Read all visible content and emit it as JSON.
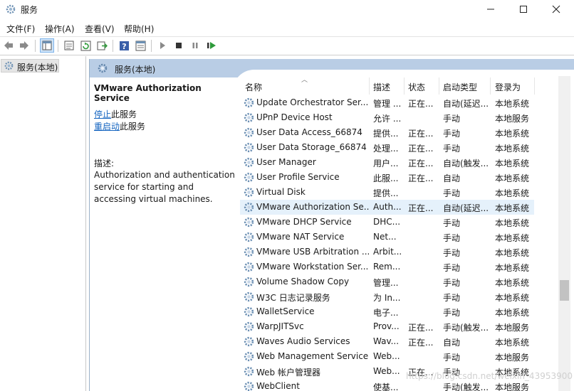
{
  "window": {
    "title": "服务",
    "minimize_icon": "minimize-icon",
    "maximize_icon": "maximize-icon",
    "close_icon": "close-icon"
  },
  "menu": [
    "文件(F)",
    "操作(A)",
    "查看(V)",
    "帮助(H)"
  ],
  "toolbar": {
    "icons": [
      "back-arrow-icon",
      "forward-arrow-icon",
      "show-console-tree-icon",
      "export-list-icon",
      "refresh-icon",
      "export-icon",
      "help-icon",
      "properties-icon",
      "start-service-icon",
      "stop-service-icon",
      "pause-service-icon",
      "restart-service-icon"
    ]
  },
  "tree": {
    "root_label": "服务(本地)"
  },
  "panel": {
    "header_label": "服务(本地)"
  },
  "details": {
    "service_title": "VMware Authorization Service",
    "stop_link": "停止",
    "stop_suffix": "此服务",
    "restart_link": "重启动",
    "restart_suffix": "此服务",
    "desc_label": "描述:",
    "desc_text": "Authorization and authentication service for starting and accessing virtual machines."
  },
  "list": {
    "columns": {
      "name": "名称",
      "desc": "描述",
      "status": "状态",
      "startup": "启动类型",
      "logon": "登录为"
    },
    "sorted_column": "名称",
    "selected_row": "VMware Authorization Se...",
    "rows": [
      {
        "name": "Update Orchestrator Ser...",
        "desc": "管理 ...",
        "status": "正在...",
        "startup": "自动(延迟...",
        "logon": "本地系统"
      },
      {
        "name": "UPnP Device Host",
        "desc": "允许 ...",
        "status": "",
        "startup": "手动",
        "logon": "本地服务"
      },
      {
        "name": "User Data Access_66874",
        "desc": "提供...",
        "status": "正在...",
        "startup": "手动",
        "logon": "本地系统"
      },
      {
        "name": "User Data Storage_66874",
        "desc": "处理...",
        "status": "正在...",
        "startup": "手动",
        "logon": "本地系统"
      },
      {
        "name": "User Manager",
        "desc": "用户...",
        "status": "正在...",
        "startup": "自动(触发...",
        "logon": "本地系统"
      },
      {
        "name": "User Profile Service",
        "desc": "此服...",
        "status": "正在...",
        "startup": "自动",
        "logon": "本地系统"
      },
      {
        "name": "Virtual Disk",
        "desc": "提供...",
        "status": "",
        "startup": "手动",
        "logon": "本地系统"
      },
      {
        "name": "VMware Authorization Se...",
        "desc": "Auth...",
        "status": "正在...",
        "startup": "自动(延迟...",
        "logon": "本地系统"
      },
      {
        "name": "VMware DHCP Service",
        "desc": "DHC...",
        "status": "",
        "startup": "手动",
        "logon": "本地系统"
      },
      {
        "name": "VMware NAT Service",
        "desc": "Net...",
        "status": "",
        "startup": "手动",
        "logon": "本地系统"
      },
      {
        "name": "VMware USB Arbitration ...",
        "desc": "Arbit...",
        "status": "",
        "startup": "手动",
        "logon": "本地系统"
      },
      {
        "name": "VMware Workstation Ser...",
        "desc": "Rem...",
        "status": "",
        "startup": "手动",
        "logon": "本地系统"
      },
      {
        "name": "Volume Shadow Copy",
        "desc": "管理...",
        "status": "",
        "startup": "手动",
        "logon": "本地系统"
      },
      {
        "name": "W3C 日志记录服务",
        "desc": "为 In...",
        "status": "",
        "startup": "手动",
        "logon": "本地系统"
      },
      {
        "name": "WalletService",
        "desc": "电子...",
        "status": "",
        "startup": "手动",
        "logon": "本地系统"
      },
      {
        "name": "WarpJITSvc",
        "desc": "Prov...",
        "status": "正在...",
        "startup": "手动(触发...",
        "logon": "本地服务"
      },
      {
        "name": "Waves Audio Services",
        "desc": "Wav...",
        "status": "正在...",
        "startup": "自动",
        "logon": "本地系统"
      },
      {
        "name": "Web Management Service",
        "desc": "Web...",
        "status": "",
        "startup": "手动",
        "logon": "本地服务"
      },
      {
        "name": "Web 帐户管理器",
        "desc": "Web...",
        "status": "正在...",
        "startup": "手动",
        "logon": "本地系统"
      },
      {
        "name": "WebClient",
        "desc": "使基...",
        "status": "",
        "startup": "手动(触发...",
        "logon": "本地服务"
      }
    ]
  },
  "colors": {
    "header_band": "#b9cde5",
    "selected_row": "#e5f1fb",
    "link": "#1565c0",
    "gear": "#6b8fb3"
  },
  "watermark": "https://blog.csdn.net/weixin_43953900"
}
